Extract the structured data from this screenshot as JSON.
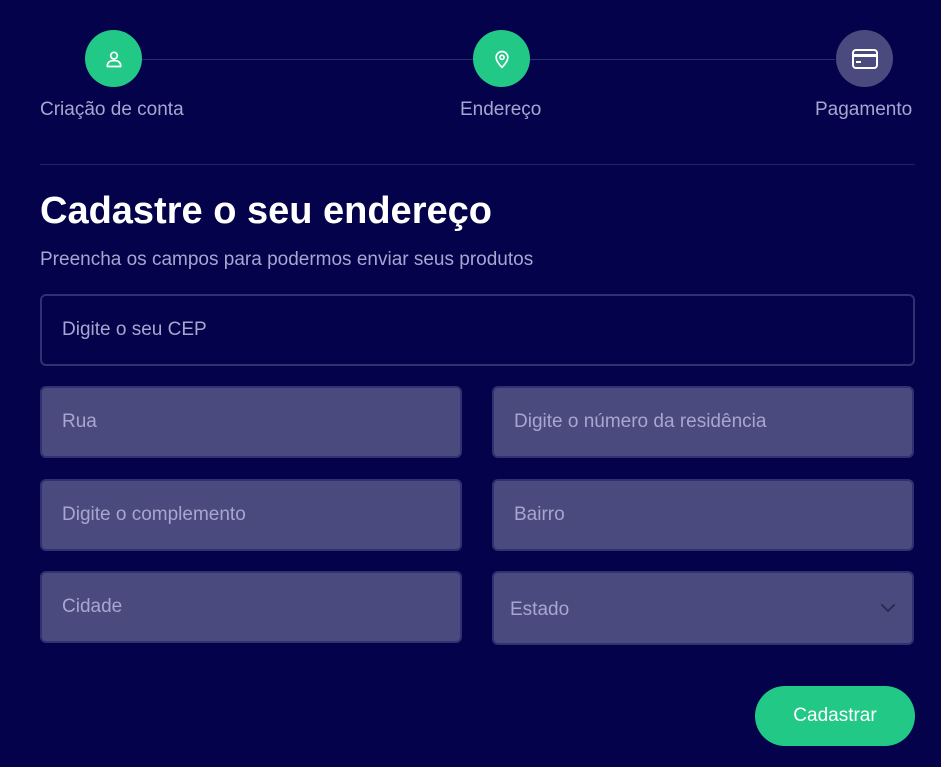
{
  "stepper": {
    "steps": [
      {
        "label": "Criação de conta",
        "icon": "user-icon",
        "state": "complete"
      },
      {
        "label": "Endereço",
        "icon": "map-pin-icon",
        "state": "active"
      },
      {
        "label": "Pagamento",
        "icon": "credit-card-icon",
        "state": "pending"
      }
    ]
  },
  "form": {
    "title": "Cadastre o seu endereço",
    "subtitle": "Preencha os campos para podermos enviar seus produtos",
    "cep": {
      "placeholder": "Digite o seu CEP",
      "value": ""
    },
    "rua": {
      "placeholder": "Rua",
      "value": ""
    },
    "numero": {
      "placeholder": "Digite o número da residência",
      "value": ""
    },
    "complemento": {
      "placeholder": "Digite o complemento",
      "value": ""
    },
    "bairro": {
      "placeholder": "Bairro",
      "value": ""
    },
    "cidade": {
      "placeholder": "Cidade",
      "value": ""
    },
    "estado": {
      "selected": "Estado"
    },
    "submit_label": "Cadastrar"
  },
  "colors": {
    "background": "#03024a",
    "accent": "#22c986",
    "input_fill": "#4a4a7e",
    "muted_text": "#a7a6d0"
  }
}
